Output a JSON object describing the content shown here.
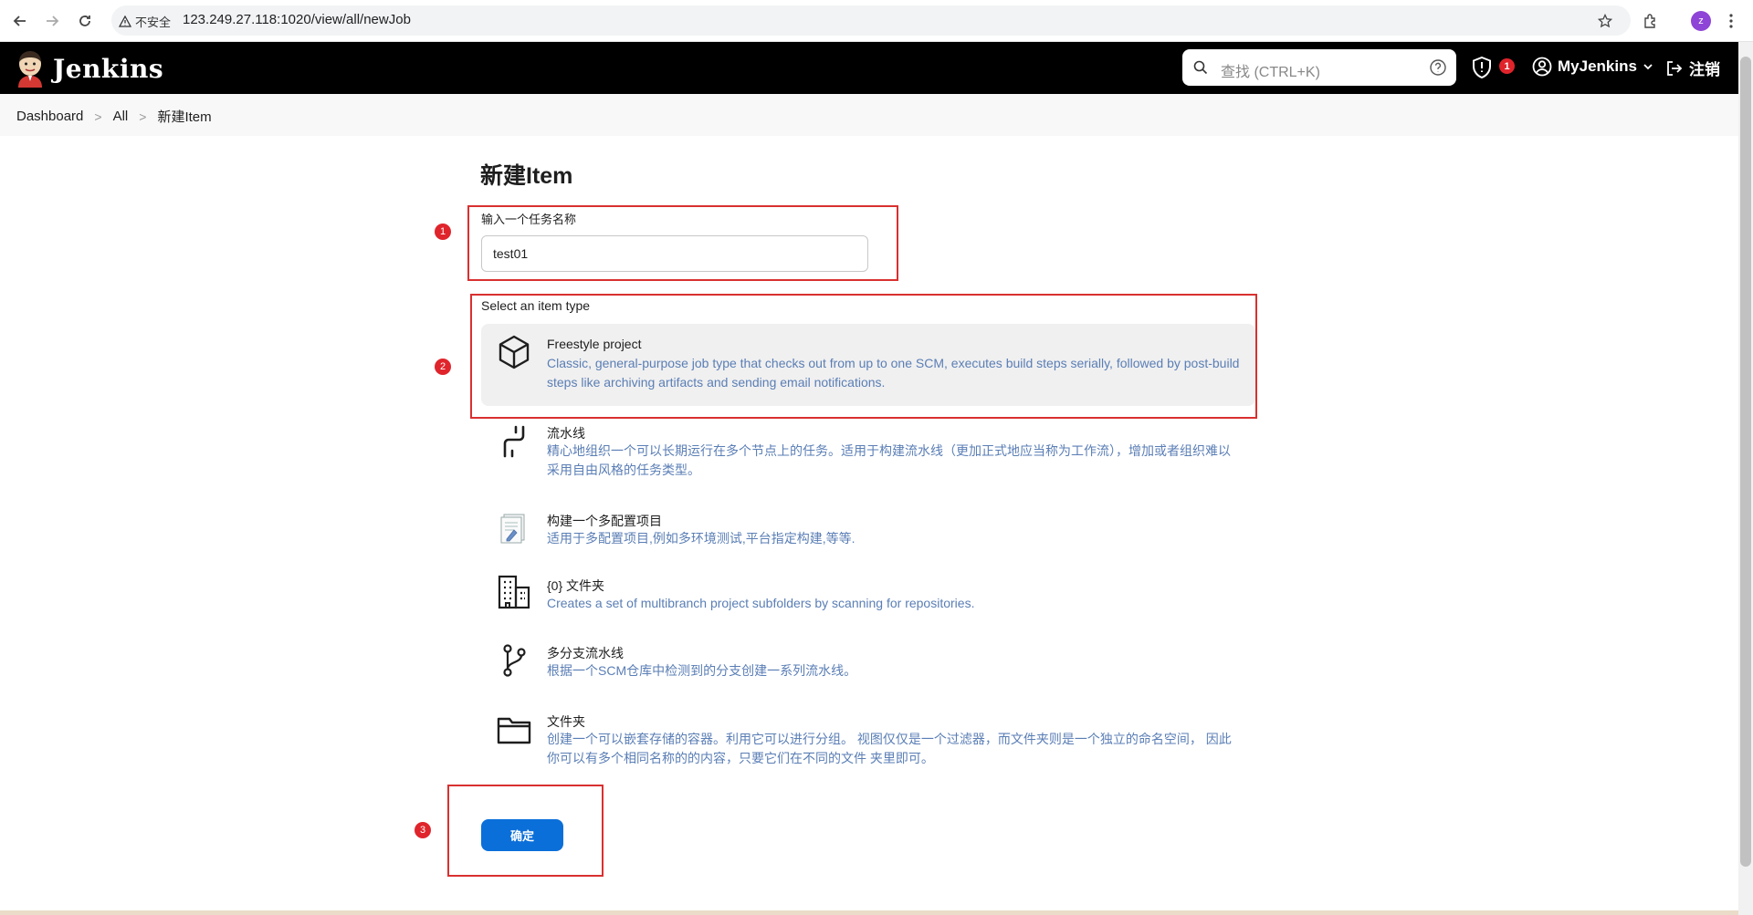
{
  "browser": {
    "security_warning": "不安全",
    "url": "123.249.27.118:1020/view/all/newJob",
    "profile_initial": "z"
  },
  "header": {
    "logo_text": "Jenkins",
    "search_placeholder": "查找 (CTRL+K)",
    "security_badge": "1",
    "user_name": "MyJenkins",
    "logout_label": "注销"
  },
  "breadcrumb": {
    "items": [
      "Dashboard",
      "All",
      "新建Item"
    ],
    "separator": ">"
  },
  "main": {
    "title": "新建Item",
    "name_label": "输入一个任务名称",
    "name_value": "test01",
    "type_label": "Select an item type",
    "items": [
      {
        "icon": "freestyle-cube-icon",
        "title": "Freestyle project",
        "description": "Classic, general-purpose job type that checks out from up to one SCM, executes build steps serially, followed by post-build steps like archiving artifacts and sending email notifications.",
        "selected": true
      },
      {
        "icon": "pipeline-icon",
        "title": "流水线",
        "description": "精心地组织一个可以长期运行在多个节点上的任务。适用于构建流水线（更加正式地应当称为工作流），增加或者组织难以采用自由风格的任务类型。"
      },
      {
        "icon": "multi-config-icon",
        "title": "构建一个多配置项目",
        "description": "适用于多配置项目,例如多环境测试,平台指定构建,等等."
      },
      {
        "icon": "organization-folder-icon",
        "title": "{0} 文件夹",
        "description": "Creates a set of multibranch project subfolders by scanning for repositories."
      },
      {
        "icon": "multibranch-icon",
        "title": "多分支流水线",
        "description": "根据一个SCM仓库中检测到的分支创建一系列流水线。"
      },
      {
        "icon": "folder-icon",
        "title": "文件夹",
        "description": "创建一个可以嵌套存储的容器。利用它可以进行分组。 视图仅仅是一个过滤器，而文件夹则是一个独立的命名空间， 因此你可以有多个相同名称的的内容，只要它们在不同的文件 夹里即可。"
      }
    ],
    "ok_label": "确定"
  },
  "annotations": [
    "1",
    "2",
    "3"
  ],
  "colors": {
    "annotation_red": "#d93030",
    "primary_button": "#0b6fd9",
    "description_blue": "#5a7eb5"
  }
}
